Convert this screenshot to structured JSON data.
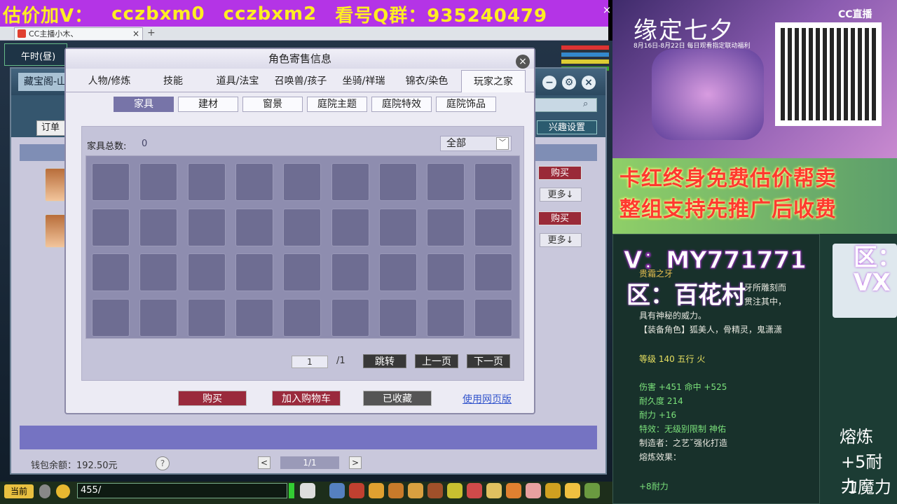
{
  "overlay": {
    "banner_text_1": "估价加V：",
    "banner_text_2": "cczbxm0",
    "banner_text_3": "cczbxm2",
    "banner_text_4": "看号Q群：935240479"
  },
  "browser": {
    "tab_title": "CC主播小木、",
    "tab_close": "×",
    "new_tab": "+"
  },
  "game": {
    "time": "午时(昼)",
    "store_tab": "藏宝阁-山",
    "interest_btn": "兴趣设置",
    "buy_label": "购买",
    "more_label": "更多↓",
    "balance": "钱包余额：192.50元",
    "help": "?",
    "page": "1/1",
    "prev": "<",
    "next": ">",
    "chat_channel": "当前",
    "chat_input": "455/"
  },
  "dialog": {
    "title": "角色寄售信息",
    "close": "×",
    "main_tabs": [
      "人物/修炼",
      "技能",
      "道具/法宝",
      "召唤兽/孩子",
      "坐骑/祥瑞",
      "锦衣/染色",
      "玩家之家"
    ],
    "sub_tabs": [
      "家具",
      "建材",
      "窗景",
      "庭院主题",
      "庭院特效",
      "庭院饰品"
    ],
    "count_label": "家具总数:",
    "count_value": "0",
    "filter_value": "全部",
    "filter_arrow": "﹀",
    "page_value": "1",
    "page_total": "/1",
    "jump": "跳转",
    "prev_page": "上一页",
    "next_page": "下一页",
    "buy": "购买",
    "add_cart": "加入购物车",
    "favorited": "已收藏",
    "web_version": "使用网页版"
  },
  "stream": {
    "ad_title": "缘定七夕",
    "ad_sub": "8月16日-8月22日 每日观看指定联动福利",
    "cc_logo": "CC直播",
    "promo_1": "卡红终身免费估价帮卖",
    "promo_2": "整组支持先推广后收费",
    "vx": "V：MY771771",
    "area": "区：百花村",
    "area_right": "区：",
    "vx_right": "VX",
    "item_name": "贵霜之牙",
    "item_desc": "牙所雕刻而",
    "item_desc2": "贯注其中，",
    "item_desc3": "具有神秘的威力。",
    "item_roles": "【装备角色】狐美人，骨精灵，鬼潇潇",
    "item_level": "等级 140  五行 火",
    "item_dmg": "伤害 +451  命中 +525",
    "item_dur": "耐久度 214",
    "item_nl": "耐力 +16",
    "item_special": "特效：无级别限制 神佑",
    "item_maker": "制造者：之艺˘强化打造",
    "item_melt": "熔炼效果：",
    "item_melt_val": "+8耐力",
    "right_melt": "熔炼",
    "right_nl": "+5耐力",
    "right_ml": "-1魔力"
  }
}
